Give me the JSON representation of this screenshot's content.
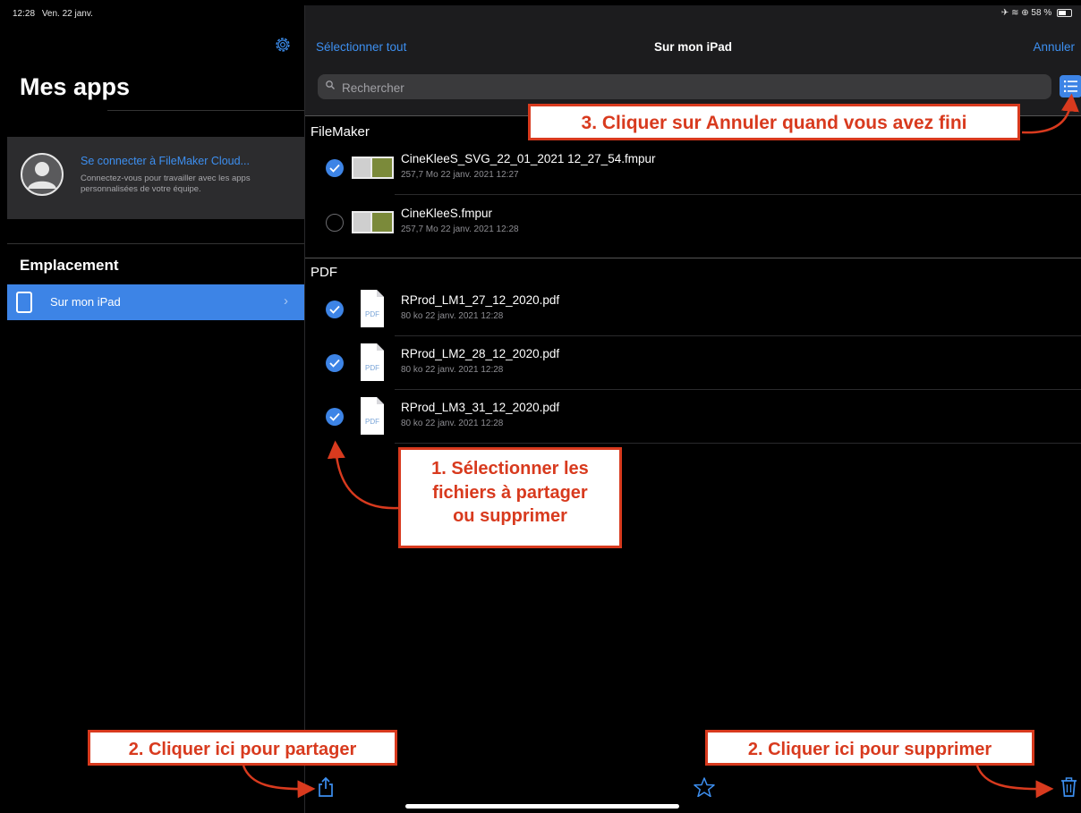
{
  "status_bar": {
    "time": "12:28",
    "date": "Ven. 22 janv.",
    "battery": "58 %"
  },
  "sidebar": {
    "title": "Mes apps",
    "cloud": {
      "title": "Se connecter à FileMaker Cloud...",
      "description": "Connectez-vous pour travailler avec les apps personnalisées de votre équipe."
    },
    "section_label": "Emplacement",
    "items": [
      {
        "label": "Sur mon iPad",
        "selected": true
      }
    ]
  },
  "header": {
    "select_all": "Sélectionner tout",
    "title": "Sur mon iPad",
    "cancel": "Annuler"
  },
  "search": {
    "placeholder": "Rechercher",
    "value": ""
  },
  "sections": [
    {
      "name": "FileMaker",
      "files": [
        {
          "name": "CineKleeS_SVG_22_01_2021 12_27_54.fmpur",
          "meta": "257,7 Mo 22 janv. 2021 12:27",
          "selected": true
        },
        {
          "name": "CineKleeS.fmpur",
          "meta": "257,7 Mo 22 janv. 2021 12:28",
          "selected": false
        }
      ]
    },
    {
      "name": "PDF",
      "files": [
        {
          "name": "RProd_LM1_27_12_2020.pdf",
          "meta": "80 ko 22 janv. 2021 12:28",
          "selected": true,
          "icon_text": "PDF"
        },
        {
          "name": "RProd_LM2_28_12_2020.pdf",
          "meta": "80 ko 22 janv. 2021 12:28",
          "selected": true,
          "icon_text": "PDF"
        },
        {
          "name": "RProd_LM3_31_12_2020.pdf",
          "meta": "80 ko 22 janv. 2021 12:28",
          "selected": true,
          "icon_text": "PDF"
        }
      ]
    }
  ],
  "toolbar": {
    "share": "share-icon",
    "favorite": "star-icon",
    "delete": "trash-icon"
  },
  "annotations": {
    "step1_line1": "1. Sélectionner les",
    "step1_line2": "fichiers à partager",
    "step1_line3": "ou supprimer",
    "step2_share": "2. Cliquer ici pour partager",
    "step2_delete": "2. Cliquer ici pour supprimer",
    "step3": "3. Cliquer sur Annuler quand vous avez fini"
  },
  "colors": {
    "accent": "#3d84e6",
    "link": "#3d8ff0",
    "annotation": "#d83a1e",
    "background": "#000000"
  }
}
